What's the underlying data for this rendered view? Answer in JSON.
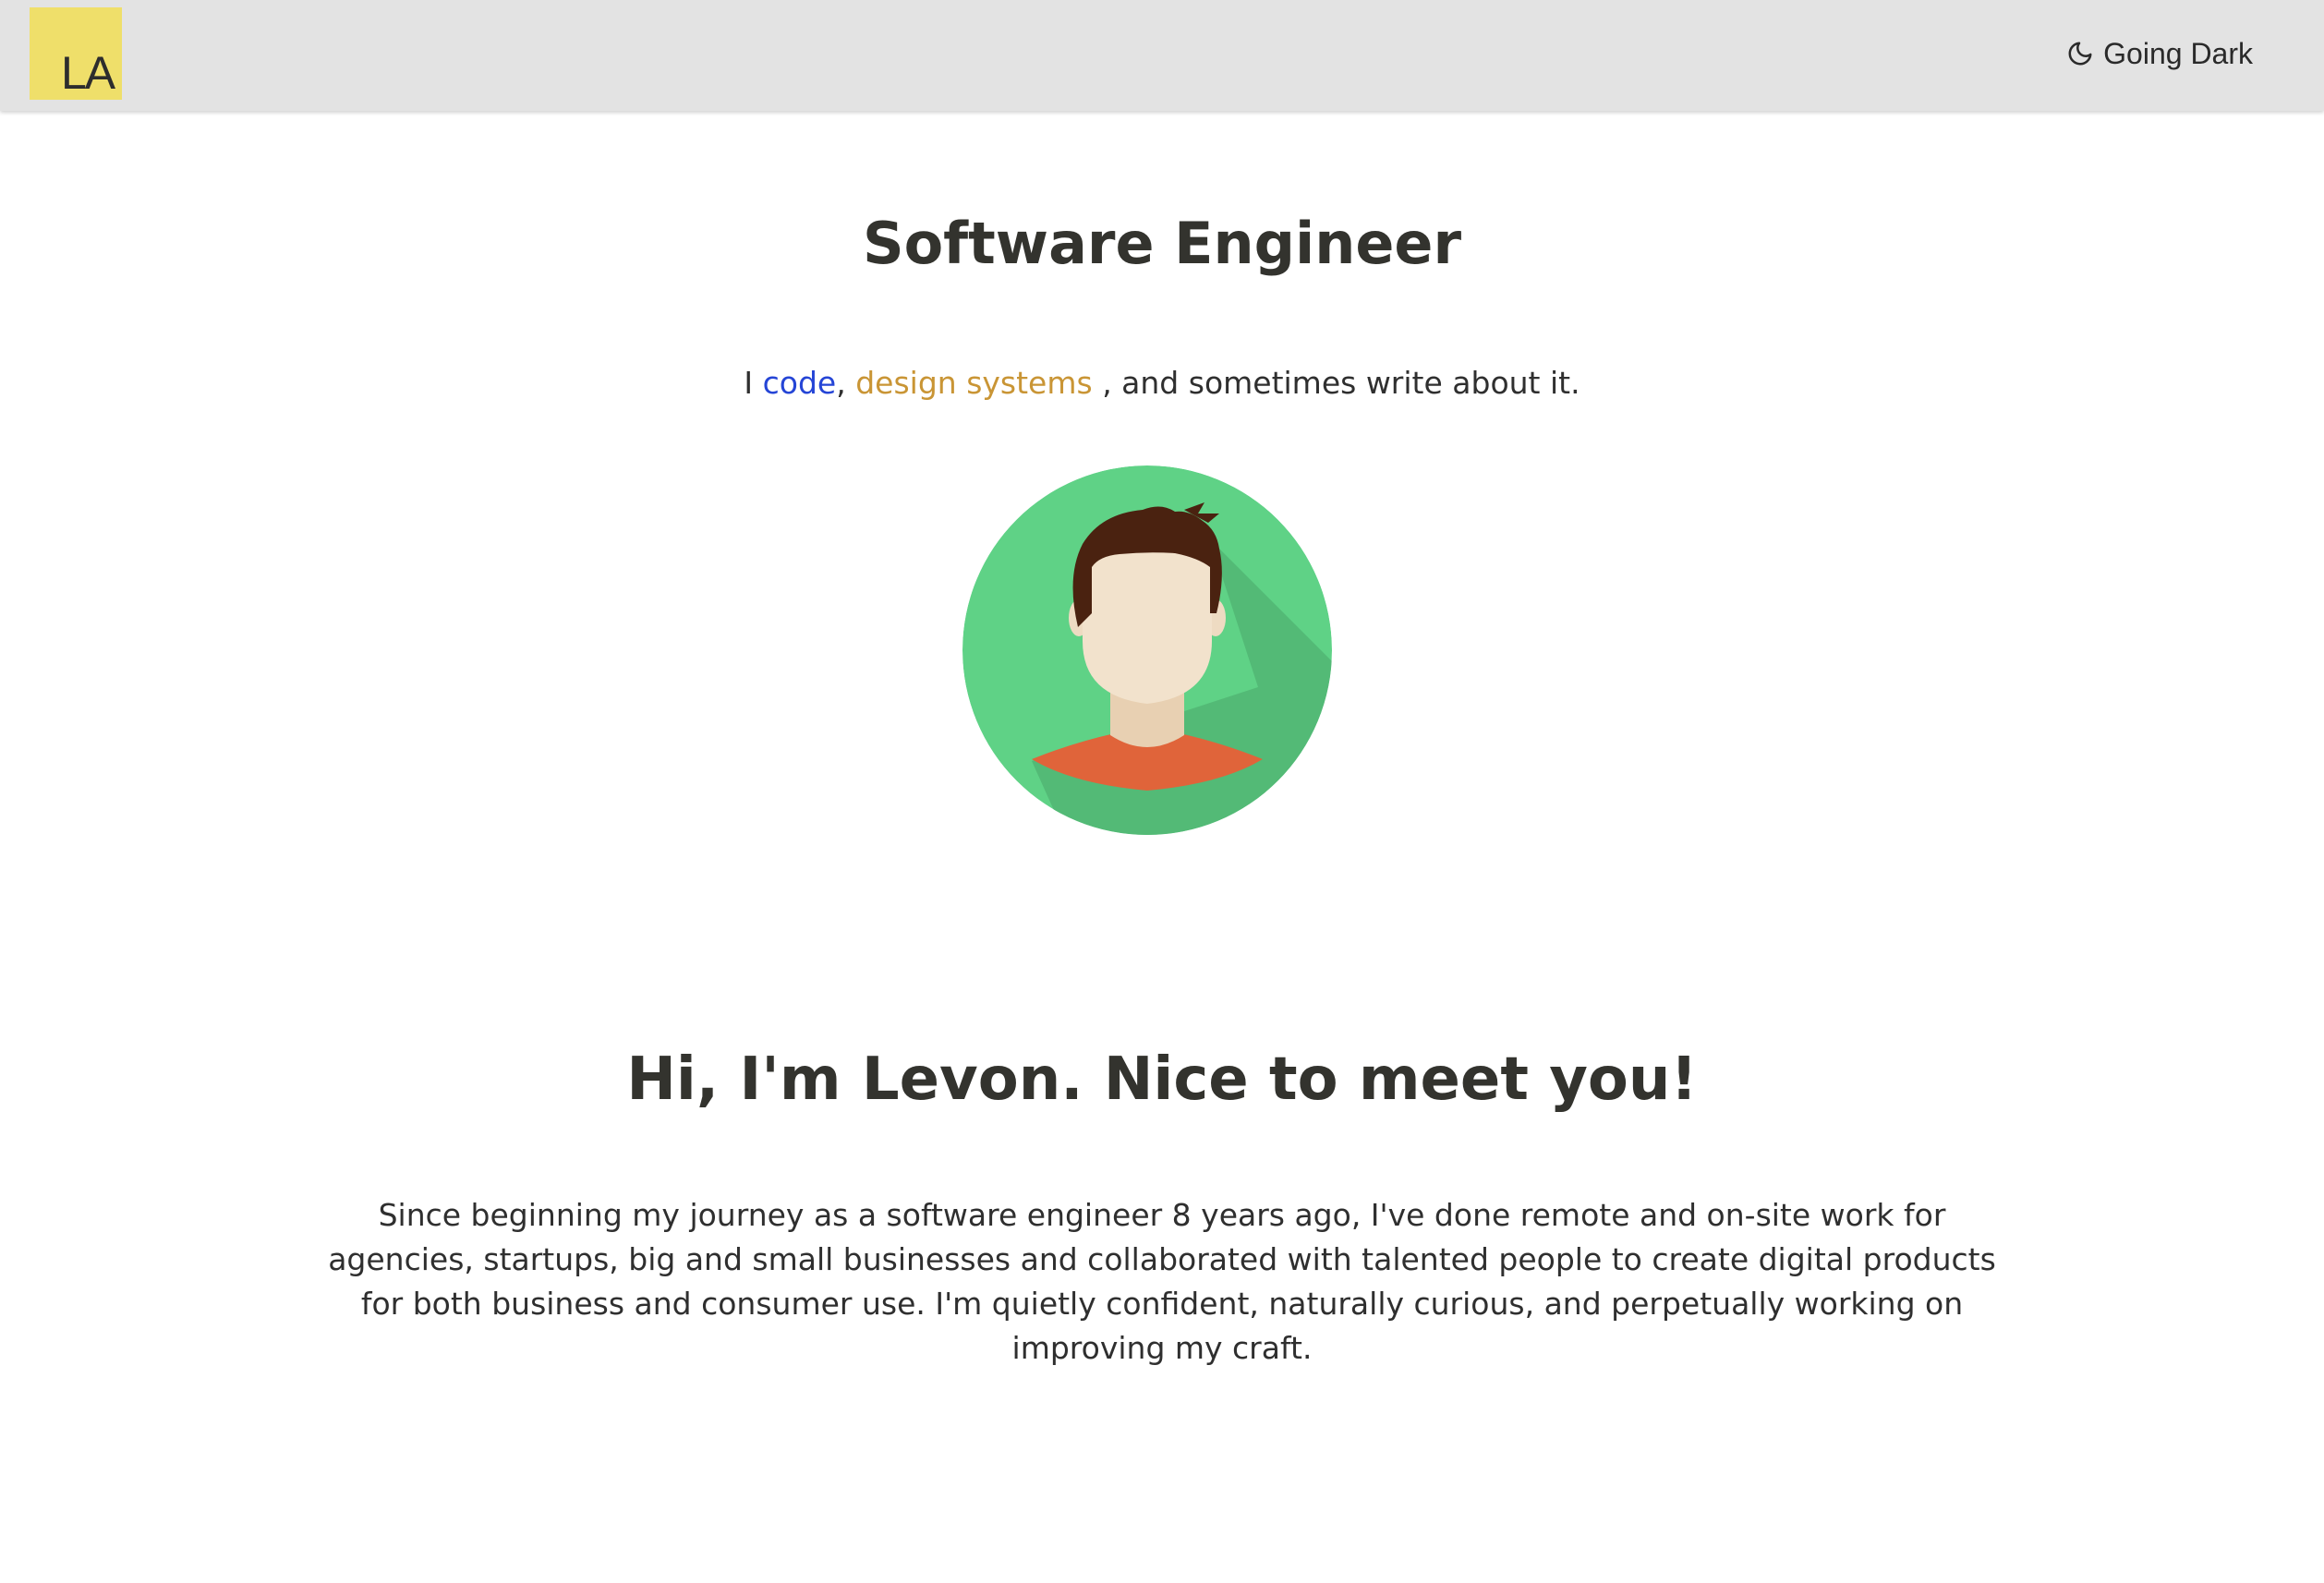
{
  "header": {
    "logo_text": "LA",
    "theme_toggle_label": "Going Dark",
    "theme_toggle_icon": "moon-icon",
    "background_color": "#e3e3e3",
    "logo_color": "#efdf6a"
  },
  "hero": {
    "title": "Software Engineer",
    "tagline": {
      "prefix": "I ",
      "link1": "code",
      "separator": ", ",
      "link2": "design systems",
      "suffix": " , and sometimes write about it."
    },
    "avatar_icon": "developer-avatar-icon",
    "avatar_bg_color": "#5fd286",
    "link1_color": "#2545d6",
    "link2_color": "#c99535"
  },
  "intro": {
    "title": "Hi, I'm Levon. Nice to meet you!",
    "body": "Since beginning my journey as a software engineer 8 years ago, I've done remote and on-site work for agencies, startups, big and small businesses and collaborated with talented people to create digital products for both business and consumer use. I'm quietly confident, naturally curious, and perpetually working on improving my craft."
  }
}
